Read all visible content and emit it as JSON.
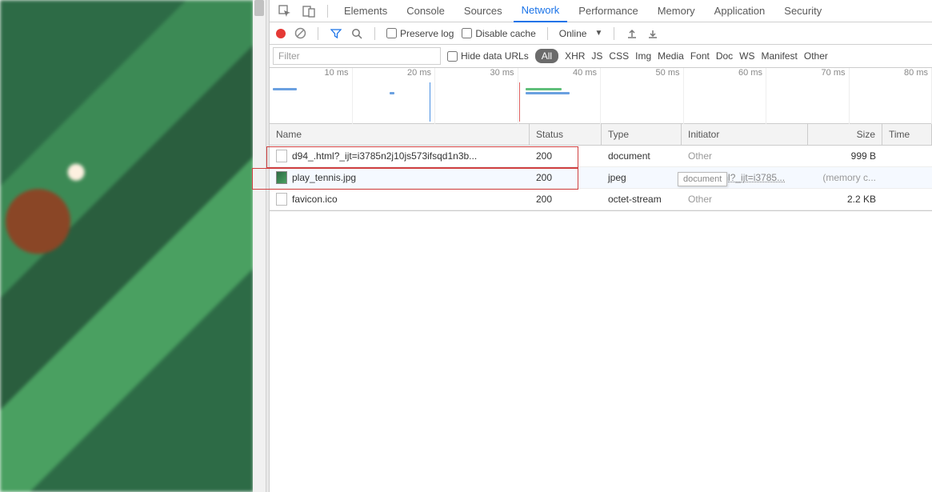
{
  "tabs": {
    "elements": "Elements",
    "console": "Console",
    "sources": "Sources",
    "network": "Network",
    "performance": "Performance",
    "memory": "Memory",
    "application": "Application",
    "security": "Security"
  },
  "toolbar": {
    "preserve_log": "Preserve log",
    "disable_cache": "Disable cache",
    "throttling_selected": "Online"
  },
  "filterbar": {
    "filter_placeholder": "Filter",
    "hide_data_urls": "Hide data URLs",
    "types": {
      "all": "All",
      "xhr": "XHR",
      "js": "JS",
      "css": "CSS",
      "img": "Img",
      "media": "Media",
      "font": "Font",
      "doc": "Doc",
      "ws": "WS",
      "manifest": "Manifest",
      "other": "Other"
    }
  },
  "overview": {
    "ticks": [
      "10 ms",
      "20 ms",
      "30 ms",
      "40 ms",
      "50 ms",
      "60 ms",
      "70 ms",
      "80 ms"
    ]
  },
  "columns": {
    "name": "Name",
    "status": "Status",
    "type": "Type",
    "initiator": "Initiator",
    "size": "Size",
    "time": "Time"
  },
  "requests": [
    {
      "name": "d94_.html?_ijt=i3785n2j10js573ifsqd1n3b...",
      "status": "200",
      "type": "document",
      "initiator": "Other",
      "size": "999 B",
      "icon": "doc"
    },
    {
      "name": "play_tennis.jpg",
      "status": "200",
      "type": "jpeg",
      "initiator": "d94_.html?_ijt=i3785...",
      "initiator_is_link": true,
      "size": "(memory c...",
      "icon": "img"
    },
    {
      "name": "favicon.ico",
      "status": "200",
      "type": "octet-stream",
      "initiator": "Other",
      "size": "2.2 KB",
      "icon": "doc"
    }
  ],
  "tooltip_text": "document"
}
